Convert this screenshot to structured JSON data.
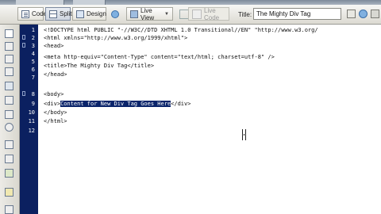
{
  "toolbar": {
    "code_label": "Code",
    "split_label": "Split",
    "design_label": "Design",
    "live_view_label": "Live View",
    "live_code_label": "Live Code",
    "title_label": "Title:",
    "title_value": "The Mighty Div Tag"
  },
  "gutter": {
    "line_numbers": [
      "1",
      "2",
      "3",
      "4",
      "5",
      "6",
      "7",
      "8",
      "9",
      "10",
      "11",
      "12"
    ]
  },
  "code": {
    "line1": "<!DOCTYPE html PUBLIC \"-//W3C//DTD XHTML 1.0 Transitional//EN\" \"http://www.w3.org/",
    "line2": "<html xmlns=\"http://www.w3.org/1999/xhtml\">",
    "line3": "<head>",
    "line4": "<meta http-equiv=\"Content-Type\" content=\"text/html; charset=utf-8\" />",
    "line5": "<title>The Mighty Div Tag</title>",
    "line6": "</head>",
    "line7": "",
    "line8": "<body>",
    "line9_before": "<div>",
    "line9_selected": "Content for New Div Tag Goes Here",
    "line9_after": "</div>",
    "line10": "</body>",
    "line11": "</html>",
    "line12": ""
  },
  "colors": {
    "gutter_bg": "#0b2060",
    "selection_bg": "#0a246a"
  }
}
